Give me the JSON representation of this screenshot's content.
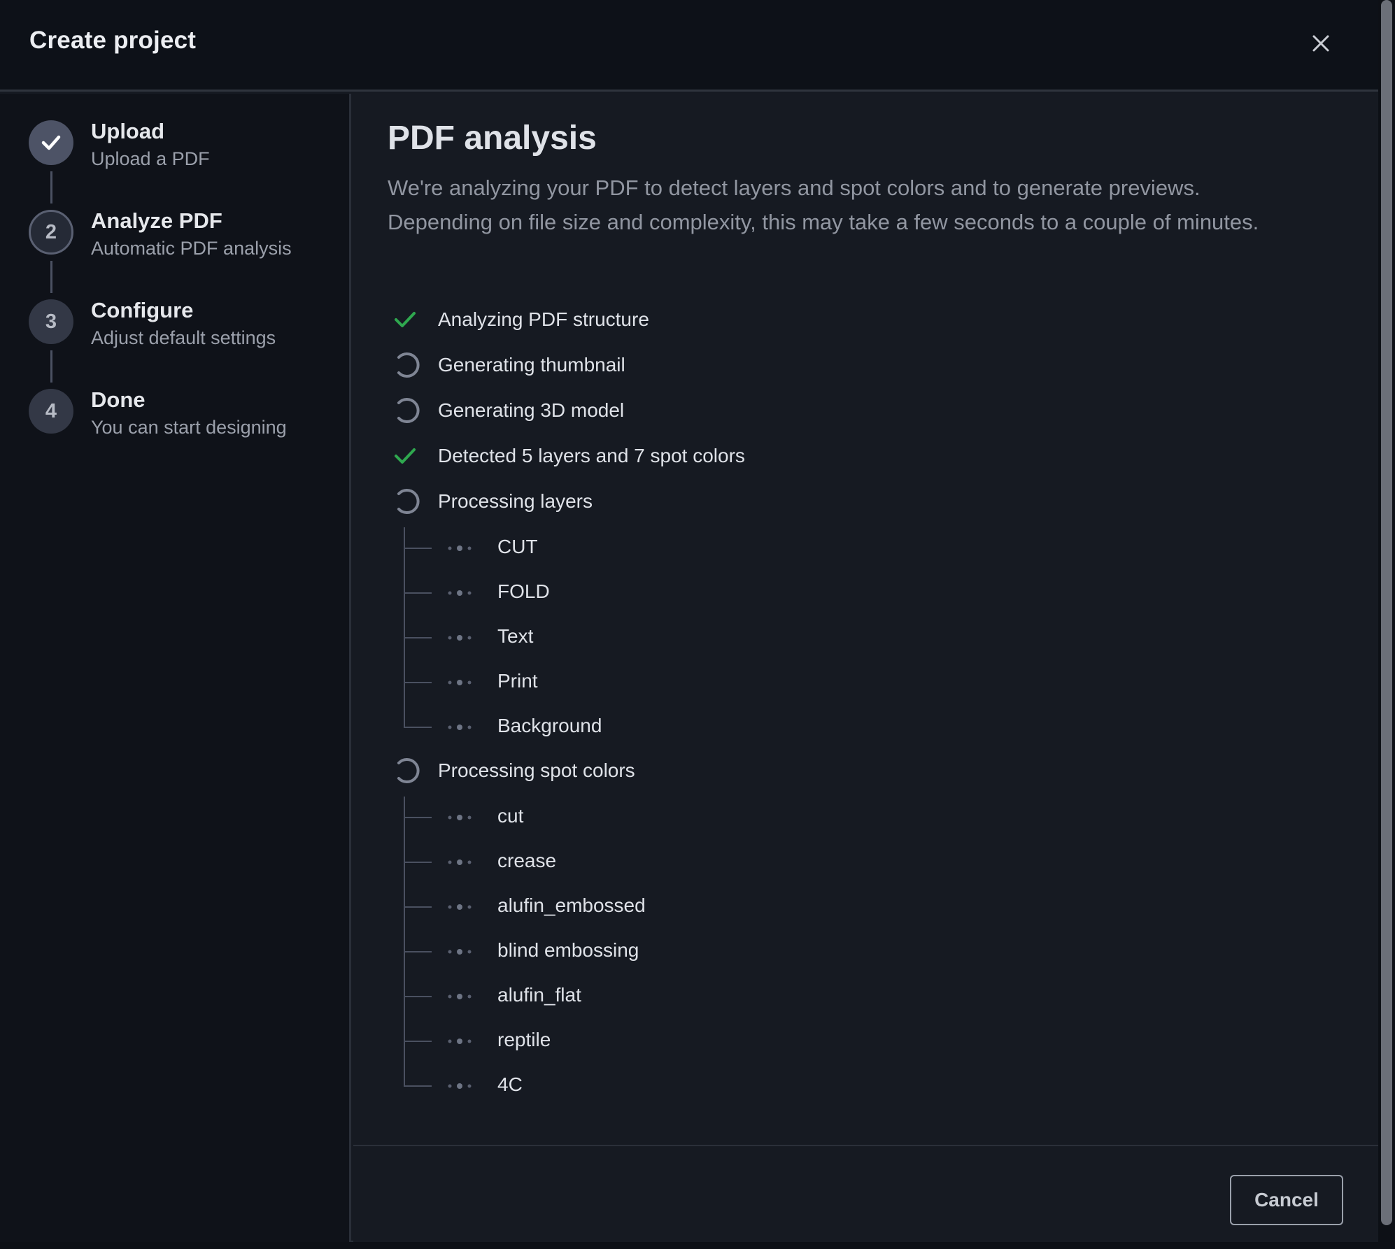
{
  "dialog": {
    "title": "Create project",
    "close_icon": "close-icon"
  },
  "steps": [
    {
      "number": "",
      "title": "Upload",
      "subtitle": "Upload a PDF",
      "state": "done"
    },
    {
      "number": "2",
      "title": "Analyze PDF",
      "subtitle": "Automatic PDF analysis",
      "state": "active"
    },
    {
      "number": "3",
      "title": "Configure",
      "subtitle": "Adjust default settings",
      "state": "pending"
    },
    {
      "number": "4",
      "title": "Done",
      "subtitle": "You can start designing",
      "state": "pending"
    }
  ],
  "main": {
    "title": "PDF analysis",
    "description": "We're analyzing your PDF to detect layers and spot colors and to generate previews. Depending on file size and complexity, this may take a few seconds to a couple of minutes.",
    "tasks": [
      {
        "label": "Analyzing PDF structure",
        "status": "done"
      },
      {
        "label": "Generating thumbnail",
        "status": "loading"
      },
      {
        "label": "Generating 3D model",
        "status": "loading"
      },
      {
        "label": "Detected 5 layers and 7 spot colors",
        "status": "done"
      },
      {
        "label": "Processing layers",
        "status": "loading",
        "children": [
          "CUT",
          "FOLD",
          "Text",
          "Print",
          "Background"
        ]
      },
      {
        "label": "Processing spot colors",
        "status": "loading",
        "children": [
          "cut",
          "crease",
          "alufin_embossed",
          "blind embossing",
          "alufin_flat",
          "reptile",
          "4C"
        ]
      }
    ]
  },
  "footer": {
    "cancel_label": "Cancel"
  },
  "colors": {
    "check": "#2fa84f",
    "spinner": "#7f8594",
    "dots": "#6e7585"
  }
}
